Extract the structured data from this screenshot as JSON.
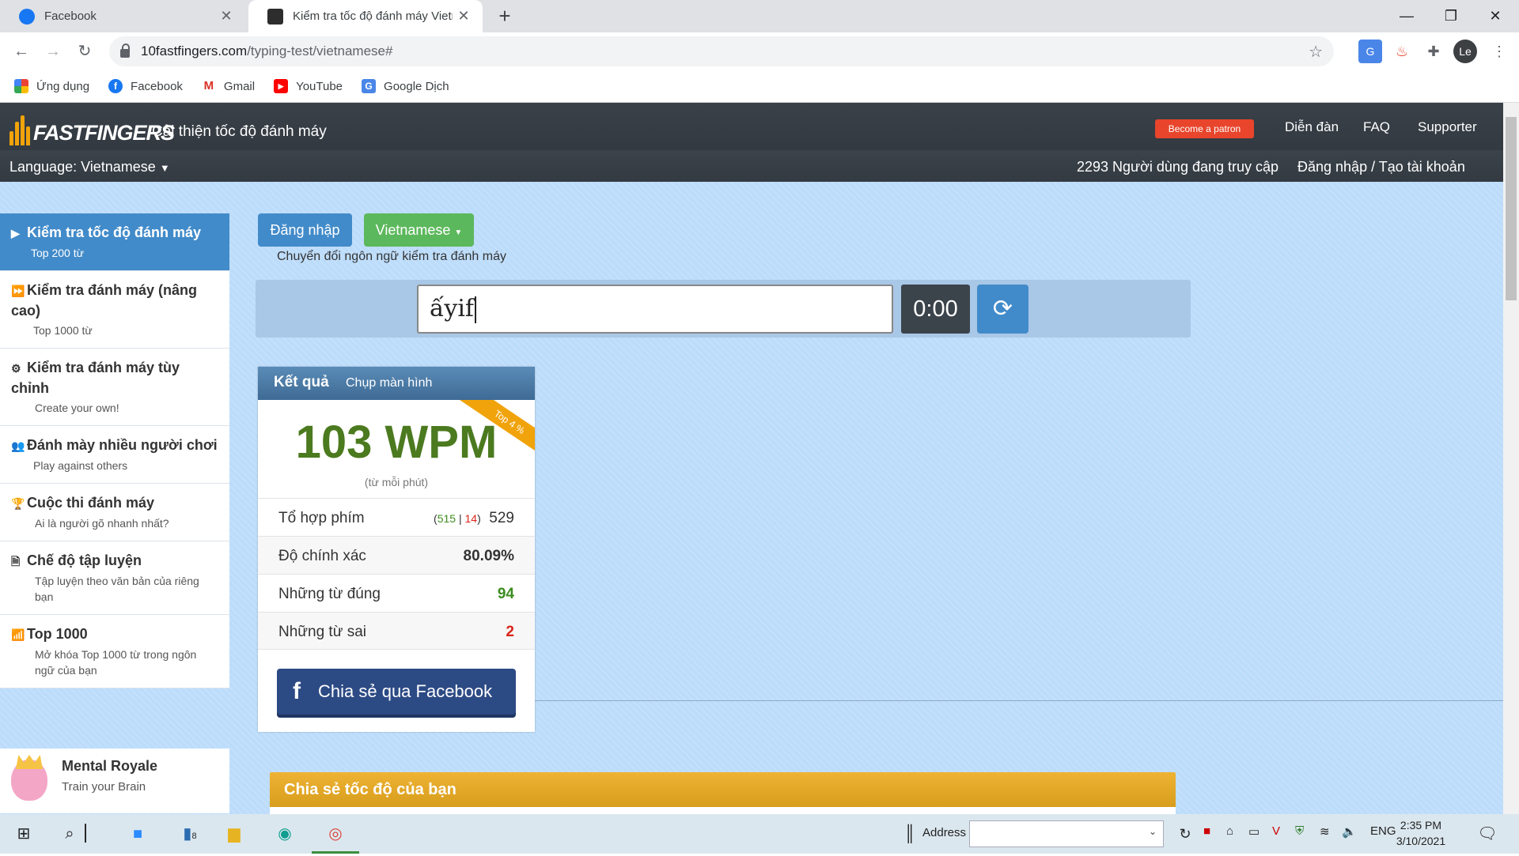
{
  "browser": {
    "tabs": [
      {
        "title": "Facebook",
        "active": false
      },
      {
        "title": "Kiểm tra tốc độ đánh máy Vietna",
        "active": true
      }
    ],
    "url_host": "10fastfingers.com",
    "url_path": "/typing-test/vietnamese#",
    "profile": "Le",
    "bookmarks": [
      {
        "label": "Ứng dụng",
        "icon": "apps-grid-icon"
      },
      {
        "label": "Facebook",
        "icon": "facebook-icon"
      },
      {
        "label": "Gmail",
        "icon": "gmail-icon"
      },
      {
        "label": "YouTube",
        "icon": "youtube-icon"
      },
      {
        "label": "Google Dịch",
        "icon": "google-translate-icon"
      }
    ]
  },
  "site": {
    "logo": "FASTFINGERS",
    "tagline": "Cải thiện tốc độ đánh máy",
    "patron": "Become a patron",
    "nav": [
      "Diễn đàn",
      "FAQ",
      "Supporter"
    ],
    "language": "Language: Vietnamese",
    "online": "2293 Người dùng đang truy cập",
    "login": "Đăng nhập / Tạo tài khoản"
  },
  "sidebar": {
    "items": [
      {
        "title": "Kiểm tra tốc độ đánh máy",
        "sub": "Top 200 từ",
        "icon": "play-icon",
        "active": true
      },
      {
        "title": "Kiểm tra đánh máy (nâng cao)",
        "sub": "Top 1000 từ",
        "icon": "fast-forward-icon"
      },
      {
        "title": "Kiểm tra đánh máy tùy chỉnh",
        "sub": "Create your own!",
        "icon": "gears-icon"
      },
      {
        "title": "Đánh mày nhiều người chơi",
        "sub": "Play against others",
        "icon": "users-icon"
      },
      {
        "title": "Cuộc thi đánh máy",
        "sub": "Ai là người gõ nhanh nhất?",
        "icon": "trophy-icon"
      },
      {
        "title": "Chế độ tập luyện",
        "sub": "Tập luyện theo văn bản của riêng bạn",
        "icon": "document-icon"
      },
      {
        "title": "Top 1000",
        "sub": "Mở khóa Top 1000 từ trong ngôn ngữ của bạn",
        "icon": "signal-bars-icon"
      }
    ],
    "promo": {
      "title": "Mental Royale",
      "sub": "Train your Brain"
    }
  },
  "controls": {
    "login_button": "Đăng nhập",
    "language_button": "Vietnamese",
    "switch_note": "Chuyển đổi ngôn ngữ kiểm tra đánh máy",
    "input_value": "ấyif",
    "timer": "0:00"
  },
  "result": {
    "tab_result": "Kết quả",
    "tab_screenshot": "Chụp màn hình",
    "ribbon": "Top 4 %",
    "wpm": "103 WPM",
    "wpm_unit": "(từ mỗi phút)",
    "keystrokes_label": "Tổ hợp phím",
    "keystrokes_correct": "515",
    "keystrokes_wrong": "14",
    "keystrokes_total": "529",
    "accuracy_label": "Độ chính xác",
    "accuracy": "80.09%",
    "correct_label": "Những từ đúng",
    "correct": "94",
    "wrong_label": "Những từ sai",
    "wrong": "2",
    "share_facebook": "Chia sẻ qua Facebook"
  },
  "share_section": {
    "title": "Chia sẻ tốc độ của bạn"
  },
  "taskbar": {
    "address_label": "Address",
    "lang": "ENG",
    "time": "2:35 PM",
    "date": "3/10/2021",
    "badge": "8"
  }
}
